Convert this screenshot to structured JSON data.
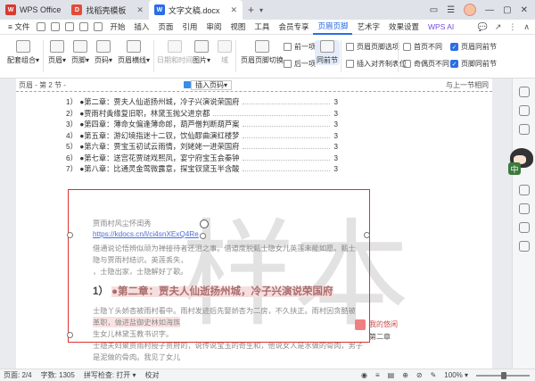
{
  "titlebar": {
    "tabs": [
      {
        "label": "WPS Office",
        "logo_text": "W",
        "logo_color": "#d83a2f"
      },
      {
        "label": "找稻壳模板",
        "logo_text": "D",
        "logo_color": "#e24b3b"
      },
      {
        "label": "文字文稿.docx",
        "logo_text": "W",
        "logo_color": "#2b6de5"
      }
    ],
    "plus": "+",
    "chevron": "▾",
    "controls": [
      "▭",
      "☰",
      "—",
      "▢",
      "✕"
    ]
  },
  "menubar": {
    "file": "≡ 文件",
    "items": [
      "开始",
      "插入",
      "页面",
      "引用",
      "审阅",
      "视图",
      "工具",
      "会员专享",
      "页眉页脚",
      "艺术字",
      "效果设置"
    ],
    "active_index": 8,
    "ai": "WPS AI",
    "right": [
      "💬",
      "↗",
      "⋮",
      "∧"
    ]
  },
  "ribbon": {
    "buttons": {
      "peise": "配套组合▾",
      "yemei": "页眉▾",
      "yejiao": "页脚▾",
      "yema": "页码▾",
      "yemeiheng": "页眉横线▾",
      "riqi": "日期和时间",
      "tupian": "图片▾",
      "yu": "域",
      "yemeiqiehuan": "页眉页脚切换",
      "qianyixiang": "前一项",
      "houyixiang": "后一项",
      "tongqianjie": "同前节"
    },
    "options": {
      "yemeixuanxiang": "页眉页脚选项",
      "charuduiqi": "插入对齐制表位",
      "shouyebutong": "首页不同",
      "jiouyebutong": "奇偶页不同",
      "yemeitongqian": "页眉同前节",
      "yejiaotongqian": "页脚同前节"
    },
    "check_mark": "✓"
  },
  "page": {
    "header_left": "页眉 - 第 2 节 -",
    "header_right": "与上一节相同",
    "insert_page_number": "插入页码▾",
    "toc": [
      {
        "text": "1） ●第二章：贾夫人仙逝扬州城，冷子兴演说荣国府",
        "page": "3"
      },
      {
        "text": "2） ●贾雨村夤缘复旧职，林黛玉抛父进京都",
        "page": "3"
      },
      {
        "text": "3） ●第四章：薄命女偏逢薄命郎，葫芦僧判断葫芦案",
        "page": "3"
      },
      {
        "text": "4） ●第五章：游幻境指迷十二钗，饮仙醪曲演红楼梦",
        "page": "3"
      },
      {
        "text": "5） ●第六章：贾宝玉初试云雨情，刘姥姥一进荣国府",
        "page": "3"
      },
      {
        "text": "6） ●第七章：送宫花贾琏戏熙凤，宴宁府宝玉会秦钟",
        "page": "3"
      },
      {
        "text": "7） ●第八章：比通灵金莺微露意，探宝钗黛玉半含酸",
        "page": "3"
      }
    ],
    "watermark": "样本",
    "body": {
      "line1": "贾雨村风尘怀闺秀",
      "link": "https://kdocs.cn/l/ci4snXExQ4Re",
      "line3": "借通说论悟辨似顽为禅接待者还泪之事。借道度脱甄士隐女儿英莲未能如愿。甄士",
      "line4": "隐与贾雨村结识。英莲丢失，",
      "line5": "，士隐出家，士隐解好了歌。",
      "chapter_num": "1）",
      "chapter_title": "●第二章：贾夫人仙逝扬州城，冷子兴演说荣国府",
      "line7a": "士隐丫头娇杏被雨村看中。雨村发迹后先娶娇杏为二房，不久扶正。雨村因贪酷被",
      "line8": "革职，做进盐御史林如海族",
      "line9": "生女儿林黛玉教书识字。",
      "line10": "士隐夫妇聚贾雨村授子贾府的，说传说宝玉的奇生和，他说女人是水做的骨肉，男子",
      "line11": "是泥做的骨肉。我见了女儿"
    },
    "comment": {
      "author": "我的悠闲",
      "ref": "第二章"
    }
  },
  "statusbar": {
    "page": "页面: 2/4",
    "words": "字数: 1305",
    "spell": "拼写检查: 打开 ▾",
    "proof": "校对",
    "right_icons": [
      "◉",
      "≡",
      "▤",
      "⊕",
      "⊘",
      "✎"
    ],
    "zoom": "100% ▾"
  }
}
